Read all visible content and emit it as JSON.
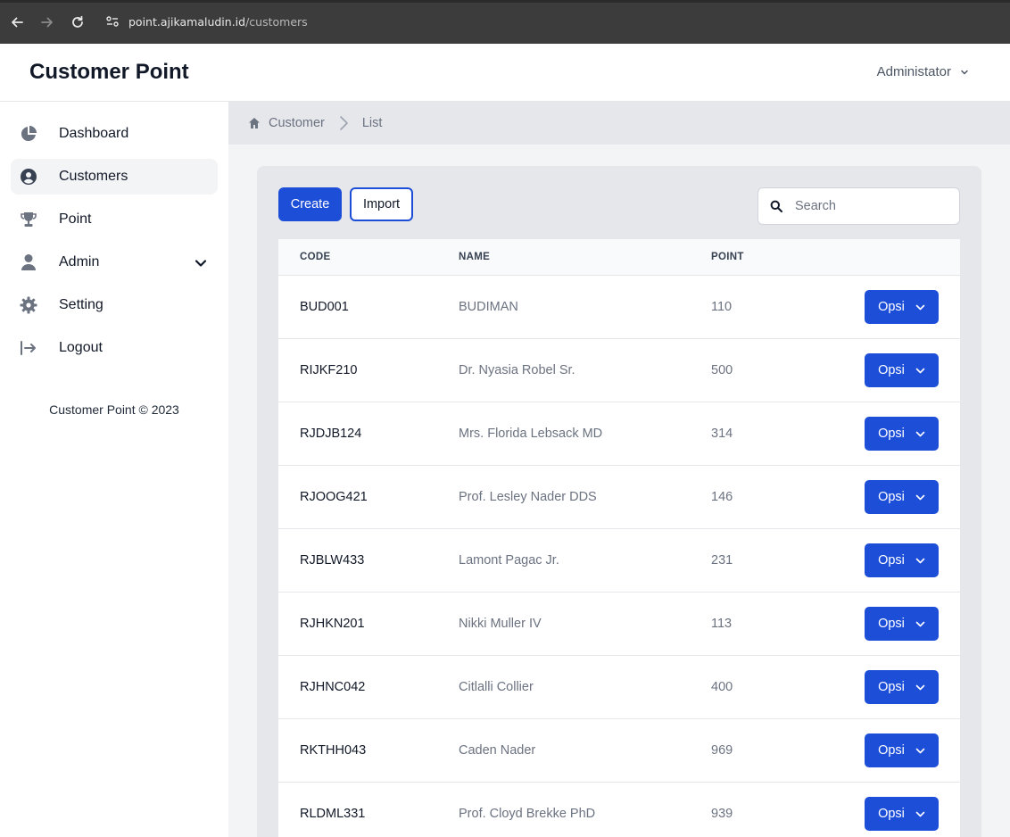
{
  "browser": {
    "url_host": "point.ajikamaludin.id",
    "url_path": "/customers"
  },
  "app": {
    "title": "Customer Point",
    "user_menu": "Administator"
  },
  "sidebar": {
    "items": [
      {
        "label": "Dashboard",
        "icon": "pie-chart-icon"
      },
      {
        "label": "Customers",
        "icon": "user-circle-icon",
        "active": true
      },
      {
        "label": "Point",
        "icon": "trophy-icon"
      },
      {
        "label": "Admin",
        "icon": "user-icon",
        "has_submenu": true
      },
      {
        "label": "Setting",
        "icon": "gear-icon"
      },
      {
        "label": "Logout",
        "icon": "logout-icon"
      }
    ],
    "footer": "Customer Point © 2023"
  },
  "breadcrumb": {
    "items": [
      "Customer",
      "List"
    ]
  },
  "toolbar": {
    "create_label": "Create",
    "import_label": "Import",
    "search_placeholder": "Search"
  },
  "table": {
    "columns": [
      "CODE",
      "NAME",
      "POINT"
    ],
    "action_label": "Opsi",
    "rows": [
      {
        "code": "BUD001",
        "name": "BUDIMAN",
        "point": "110"
      },
      {
        "code": "RIJKF210",
        "name": "Dr. Nyasia Robel Sr.",
        "point": "500"
      },
      {
        "code": "RJDJB124",
        "name": "Mrs. Florida Lebsack MD",
        "point": "314"
      },
      {
        "code": "RJOOG421",
        "name": "Prof. Lesley Nader DDS",
        "point": "146"
      },
      {
        "code": "RJBLW433",
        "name": "Lamont Pagac Jr.",
        "point": "231"
      },
      {
        "code": "RJHKN201",
        "name": "Nikki Muller IV",
        "point": "113"
      },
      {
        "code": "RJHNC042",
        "name": "Citlalli Collier",
        "point": "400"
      },
      {
        "code": "RKTHH043",
        "name": "Caden Nader",
        "point": "969"
      },
      {
        "code": "RLDML331",
        "name": "Prof. Cloyd Brekke PhD",
        "point": "939"
      }
    ]
  },
  "colors": {
    "primary": "#1d4ed8",
    "sidebar_active_bg": "#f3f4f6",
    "content_bg": "#f3f4f6"
  }
}
